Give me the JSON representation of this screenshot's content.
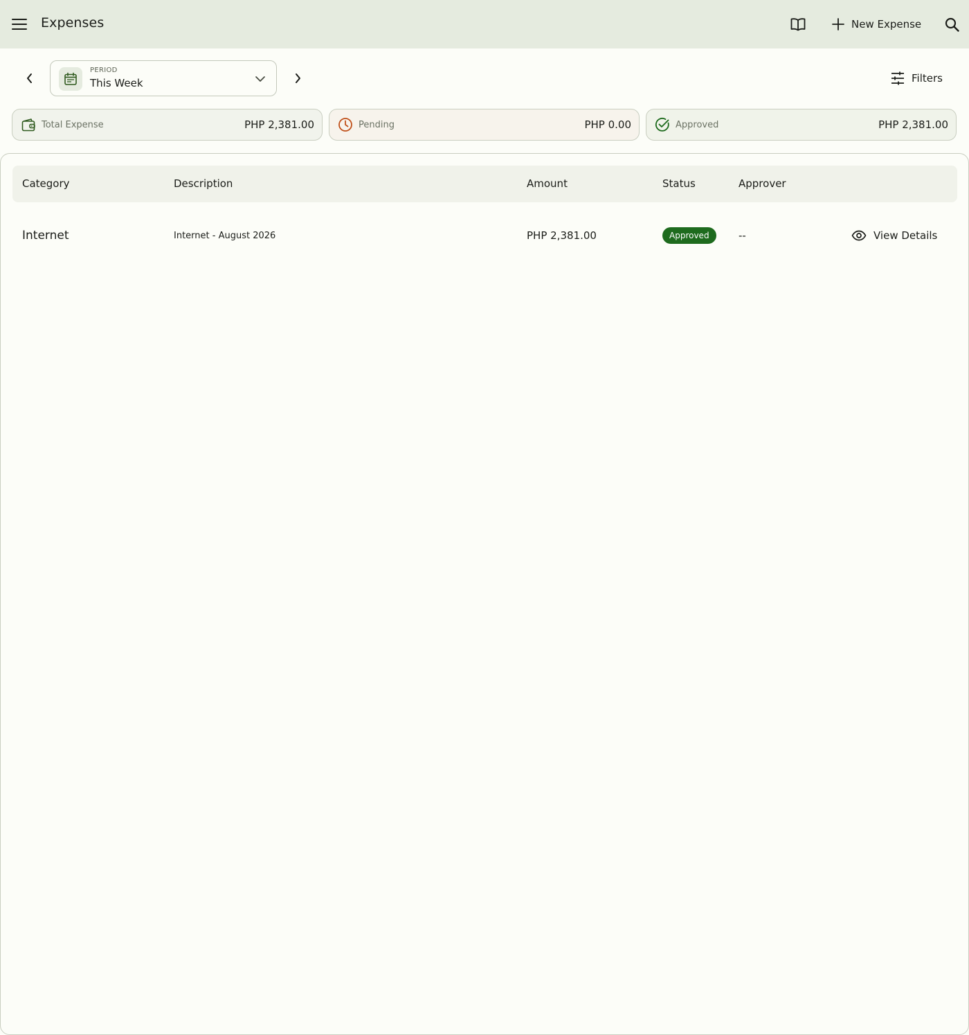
{
  "app_bar": {
    "title": "Expenses",
    "new_expense_label": "New Expense",
    "icons": [
      "menu-icon",
      "book-icon",
      "plus-icon",
      "search-icon"
    ]
  },
  "period": {
    "caption": "PERIOD",
    "value": "This Week",
    "icons": [
      "calendar-icon",
      "chevron-down-icon",
      "chevron-left-icon",
      "chevron-right-icon"
    ]
  },
  "filters": {
    "label": "Filters",
    "icon": "tune-icon"
  },
  "summary": {
    "total": {
      "label": "Total Expense",
      "value": "PHP 2,381.00",
      "icon": "wallet-icon"
    },
    "pending": {
      "label": "Pending",
      "value": "PHP 0.00",
      "icon": "clock-icon"
    },
    "approved": {
      "label": "Approved",
      "value": "PHP 2,381.00",
      "icon": "check-circle-icon"
    }
  },
  "table": {
    "columns": [
      "Category",
      "Description",
      "Amount",
      "Status",
      "Approver"
    ],
    "rows": [
      {
        "category": "Internet",
        "description": "Internet - August 2026",
        "amount": "PHP 2,381.00",
        "status": "Approved",
        "approver": "--",
        "action_label": "View Details",
        "action_icon": "eye-icon"
      }
    ]
  },
  "colors": {
    "app_bar_bg": "#e5ebdf",
    "page_bg": "#fcfdf8",
    "primary_green": "#1e6b1e",
    "pending_orange": "#c0501a",
    "outline": "#c9cec0"
  }
}
